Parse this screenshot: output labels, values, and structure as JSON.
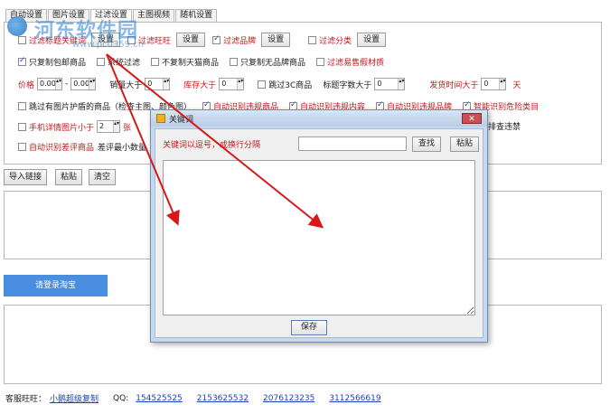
{
  "watermark": {
    "title": "河东软件园",
    "url": "www.pc0359.cn"
  },
  "tabs": [
    {
      "label": "自动设置",
      "active": false
    },
    {
      "label": "图片设置",
      "active": false
    },
    {
      "label": "过滤设置",
      "active": true
    },
    {
      "label": "主图视频",
      "active": false
    },
    {
      "label": "随机设置",
      "active": false
    }
  ],
  "filters": {
    "row1": {
      "title_keyword": "过滤标题关键词",
      "setup1": "设置",
      "wangwang": "过滤旺旺",
      "setup2": "设置",
      "brand": "过滤品牌",
      "setup3": "设置",
      "category": "过滤分类",
      "setup4": "设置"
    },
    "row2": {
      "free_shipping": "只复制包邮商品",
      "system_filter": "系统过滤",
      "no_tmall": "不复制天猫商品",
      "no_brand_only": "只复制无品牌商品",
      "easy_banned": "过滤易售假材质"
    },
    "row3": {
      "price": "价格",
      "price_min": "0.00",
      "dash": "-",
      "price_max": "0.00",
      "sales": "销量大于",
      "sales_val": "0",
      "stock": "库存大于",
      "stock_val": "0",
      "skip_3c": "跳过3C商品",
      "title_len": "标题字数大于",
      "title_len_val": "0",
      "ship_time": "发货时间大于",
      "ship_time_val": "0",
      "days": "天"
    },
    "row4": {
      "skip_shield": "跳过有图片护盾的商品（检查主图、颜色图）",
      "auto_detect_violation": "自动识别违规商品",
      "auto_detect_ch": "自动识别违规内容",
      "auto_detect_brand": "自动识别违规品牌",
      "smart_risk": "智能识别危险类目"
    },
    "row5": {
      "mobile_detail": "手机详情图片小于",
      "mobile_detail_val": "2",
      "unit": "张",
      "filter_banned": "排查违禁"
    },
    "row6": {
      "auto_detect_bad_review": "自动识别差评商品",
      "bad_review_min": "差评最小数量"
    }
  },
  "toolbar": {
    "import_link": "导入链接",
    "paste": "粘贴",
    "clear": "清空"
  },
  "login_button": "请登录淘宝",
  "footer": {
    "wangwang_label": "客服旺旺：",
    "wangwang_name": "小鹅超级复制",
    "qq_label": "QQ:",
    "qq1": "154525525",
    "qq2": "2153625532",
    "qq3": "2076123235",
    "qq4": "3112566619"
  },
  "dialog": {
    "title": "关键词",
    "close": "✕",
    "hint": "关键词以逗号，或换行分隔",
    "find": "查找",
    "paste": "粘贴",
    "save": "保存",
    "search_value": "",
    "text_value": ""
  },
  "colors": {
    "accent": "#4a8ee0",
    "red_text": "#c0191e",
    "arrow": "#d81818",
    "link": "#1a3fbf"
  }
}
